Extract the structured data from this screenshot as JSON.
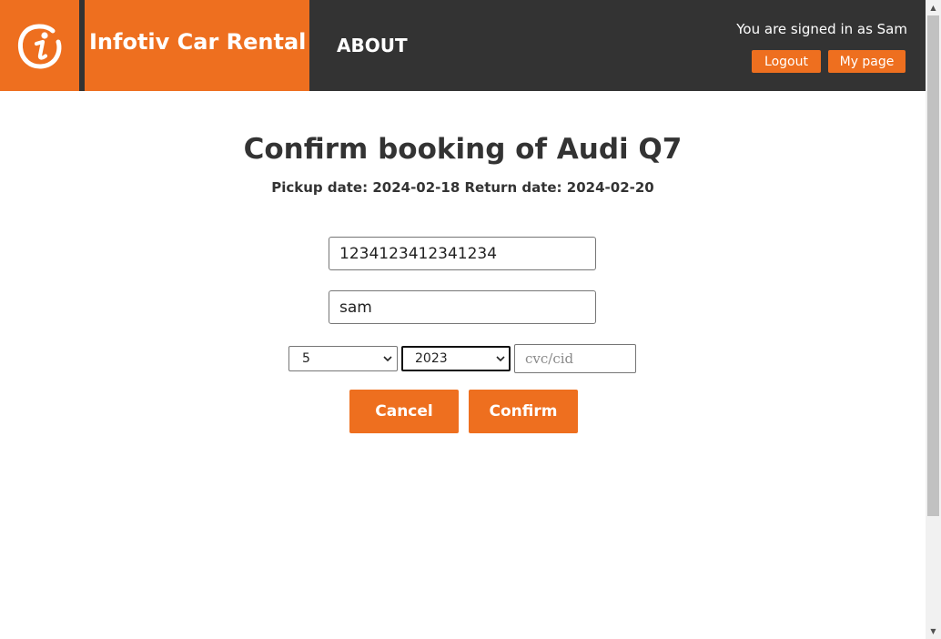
{
  "header": {
    "brand_title": "Infotiv Car Rental",
    "logo_icon": "infotiv-logo-icon",
    "nav_about": "ABOUT",
    "signed_in_text": "You are signed in as Sam",
    "logout_label": "Logout",
    "mypage_label": "My page"
  },
  "booking": {
    "heading": "Confirm booking of Audi Q7",
    "dates_text": "Pickup date: 2024-02-18 Return date: 2024-02-20"
  },
  "form": {
    "card_number_value": "1234123412341234",
    "card_name_value": "sam",
    "month_selected": "5",
    "year_selected": "2023",
    "cvc_placeholder": "cvc/cid",
    "cvc_value": "",
    "cancel_label": "Cancel",
    "confirm_label": "Confirm"
  },
  "colors": {
    "accent": "#ee6f1f",
    "header_bg": "#333333",
    "text": "#333333"
  }
}
